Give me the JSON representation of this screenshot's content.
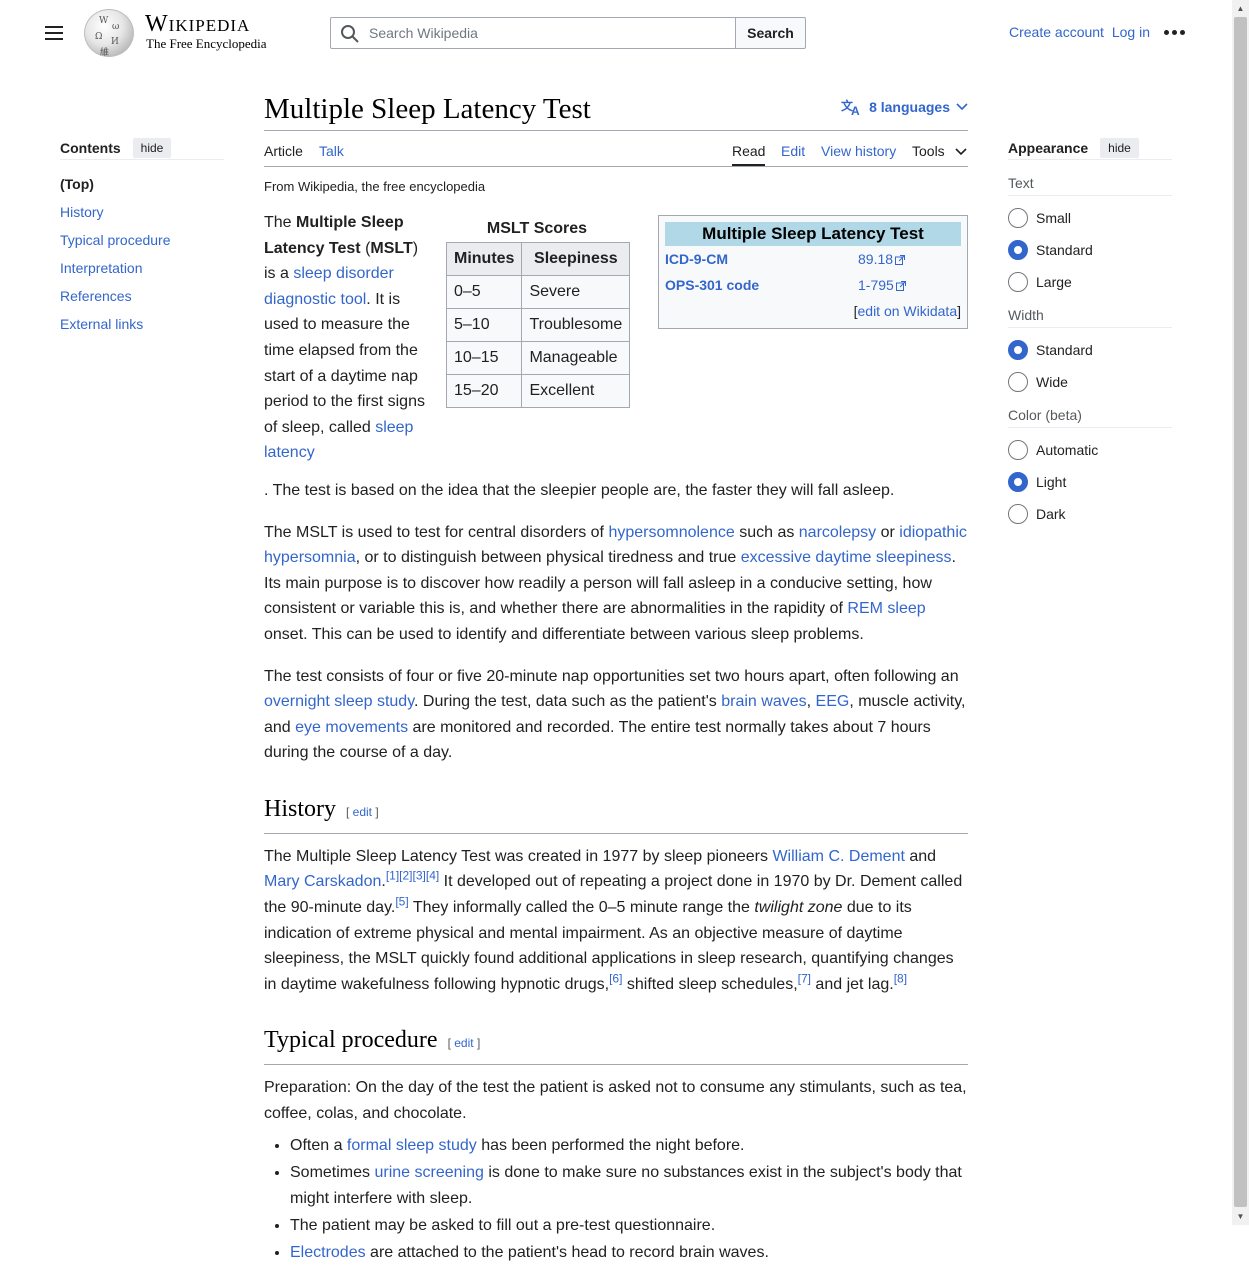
{
  "header": {
    "wordmark": "Wikipedia",
    "tagline": "The Free Encyclopedia",
    "search_placeholder": "Search Wikipedia",
    "search_button": "Search",
    "create_account": "Create account",
    "log_in": "Log in"
  },
  "toc": {
    "title": "Contents",
    "hide": "hide",
    "items": [
      "(Top)",
      "History",
      "Typical procedure",
      "Interpretation",
      "References",
      "External links"
    ]
  },
  "appearance": {
    "title": "Appearance",
    "hide": "hide",
    "text_label": "Text",
    "text_options": [
      "Small",
      "Standard",
      "Large"
    ],
    "text_selected": "Standard",
    "width_label": "Width",
    "width_options": [
      "Standard",
      "Wide"
    ],
    "width_selected": "Standard",
    "color_label": "Color (beta)",
    "color_options": [
      "Automatic",
      "Light",
      "Dark"
    ],
    "color_selected": "Light"
  },
  "article": {
    "title": "Multiple Sleep Latency Test",
    "languages": "8 languages",
    "tabs_left": [
      "Article",
      "Talk"
    ],
    "tabs_right": [
      "Read",
      "Edit",
      "View history",
      "Tools"
    ],
    "tagline": "From Wikipedia, the free encyclopedia"
  },
  "mslt_table": {
    "caption": "MSLT Scores",
    "headers": [
      "Minutes",
      "Sleepiness"
    ],
    "rows": [
      [
        "0–5",
        "Severe"
      ],
      [
        "5–10",
        "Troublesome"
      ],
      [
        "10–15",
        "Manageable"
      ],
      [
        "15–20",
        "Excellent"
      ]
    ]
  },
  "infobox": {
    "title": "Multiple Sleep Latency Test",
    "rows": [
      {
        "key": "ICD-9-CM",
        "value": "89.18"
      },
      {
        "key": "OPS-301 code",
        "value": "1-795"
      }
    ],
    "edit": "edit on Wikidata"
  },
  "text": {
    "lead_a": "The ",
    "lead_b": "Multiple Sleep Latency Test",
    "lead_c": " (",
    "lead_d": "MSLT",
    "lead_e": ") is a ",
    "lead_link1": "sleep disorder diagnostic tool",
    "lead_f": ". It is used to measure the time elapsed from the start of a daytime nap period to the first signs of sleep, called ",
    "lead_link2": "sleep latency",
    "lead_g": ". The test is based on the idea that the sleepier people are, the faster they will fall asleep.",
    "p2_a": "The MSLT is used to test for central disorders of ",
    "p2_l1": "hypersomnolence",
    "p2_b": " such as ",
    "p2_l2": "narcolepsy",
    "p2_c": " or ",
    "p2_l3": "idiopathic hypersomnia",
    "p2_d": ", or to distinguish between physical tiredness and true ",
    "p2_l4": "excessive daytime sleepiness",
    "p2_e": ". Its main purpose is to discover how readily a person will fall asleep in a conducive setting, how consistent or variable this is, and whether there are abnormalities in the rapidity of ",
    "p2_l5": "REM sleep",
    "p2_f": " onset. This can be used to identify and differentiate between various sleep problems.",
    "p3_a": "The test consists of four or five 20-minute nap opportunities set two hours apart, often following an ",
    "p3_l1": "overnight sleep study",
    "p3_b": ". During the test, data such as the patient's ",
    "p3_l2": "brain waves",
    "p3_c": ", ",
    "p3_l3": "EEG",
    "p3_d": ", muscle activity, and ",
    "p3_l4": "eye movements",
    "p3_e": " are monitored and recorded. The entire test normally takes about 7 hours during the course of a day.",
    "history_heading": "History",
    "edit": "edit",
    "h_a": "The Multiple Sleep Latency Test was created in 1977 by sleep pioneers ",
    "h_l1": "William C. Dement",
    "h_b": " and ",
    "h_l2": "Mary Carskadon",
    "h_c": ".",
    "h_refs1": "[1][2][3][4]",
    "h_d": " It developed out of repeating a project done in 1970 by Dr. Dement called the 90-minute day.",
    "h_ref5": "[5]",
    "h_e": " They informally called the 0–5 minute range the ",
    "h_em": "twilight zone",
    "h_f": " due to its indication of extreme physical and mental impairment. As an objective measure of daytime sleepiness, the MSLT quickly found additional applications in sleep research, quantifying changes in daytime wakefulness following hypnotic drugs,",
    "h_ref6": "[6]",
    "h_g": " shifted sleep schedules,",
    "h_ref7": "[7]",
    "h_h": " and jet lag.",
    "h_ref8": "[8]",
    "proc_heading": "Typical procedure",
    "proc_a": "Preparation: On the day of the test the patient is asked not to consume any stimulants, such as tea, coffee, colas, and chocolate.",
    "b1_a": "Often a ",
    "b1_l": "formal sleep study",
    "b1_b": " has been performed the night before.",
    "b2_a": "Sometimes ",
    "b2_l": "urine screening",
    "b2_b": " is done to make sure no substances exist in the subject's body that might interfere with sleep.",
    "b3": "The patient may be asked to fill out a pre-test questionnaire.",
    "b4_l": "Electrodes",
    "b4_b": " are attached to the patient's head to record brain waves."
  }
}
